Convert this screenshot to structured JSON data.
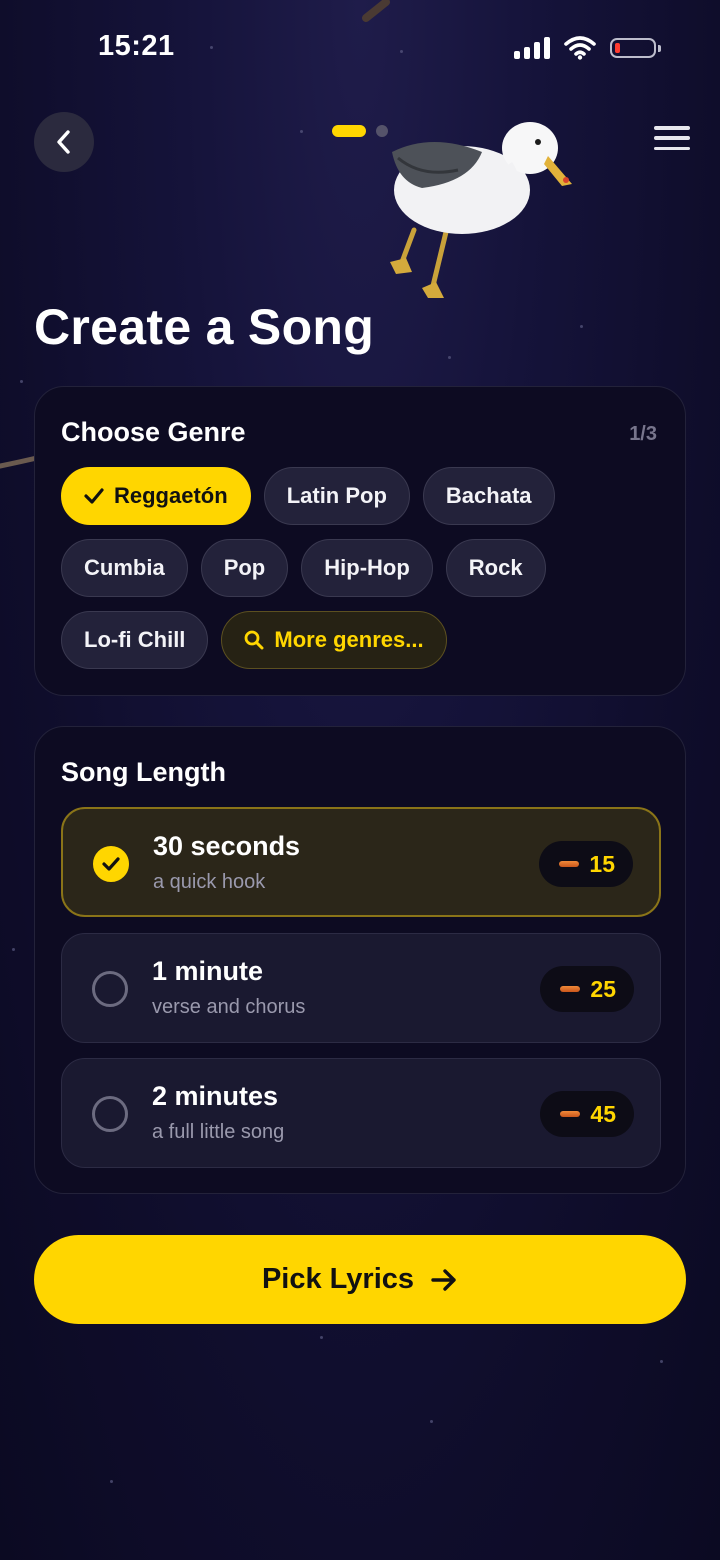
{
  "status_bar": {
    "time": "15:21"
  },
  "page": {
    "title": "Create a Song"
  },
  "genre": {
    "title": "Choose Genre",
    "count": "1/3",
    "chips": [
      "Reggaetón",
      "Latin Pop",
      "Bachata",
      "Cumbia",
      "Pop",
      "Hip-Hop",
      "Rock",
      "Lo-fi Chill"
    ],
    "selected": "Reggaetón",
    "more_label": "More genres..."
  },
  "length": {
    "title": "Song Length",
    "options": [
      {
        "title": "30 seconds",
        "subtitle": "a quick hook",
        "cost": "15",
        "selected": true
      },
      {
        "title": "1 minute",
        "subtitle": "verse and chorus",
        "cost": "25",
        "selected": false
      },
      {
        "title": "2 minutes",
        "subtitle": "a full little song",
        "cost": "45",
        "selected": false
      }
    ]
  },
  "cta": {
    "label": "Pick Lyrics"
  },
  "colors": {
    "accent": "#ffd600",
    "background": "#14123a",
    "card": "#0d0b22",
    "chip": "#23223a"
  },
  "icons": [
    "back-arrow-icon",
    "menu-icon",
    "check-icon",
    "search-icon",
    "coin-icon",
    "arrow-right-icon"
  ]
}
